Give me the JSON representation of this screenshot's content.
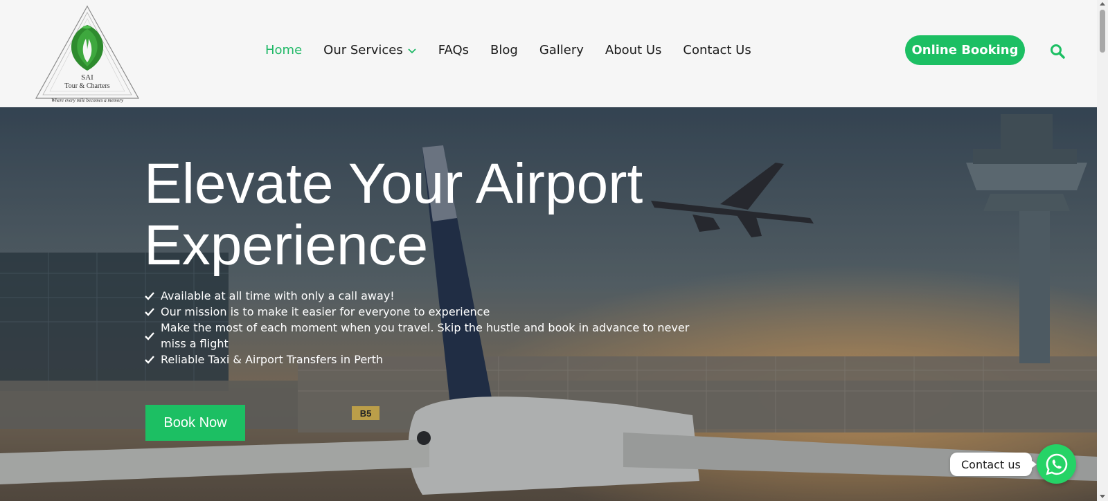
{
  "logo": {
    "name": "SAI",
    "subtitle": "Tour & Charters",
    "tagline": "Where every mile becomes a memory"
  },
  "nav": {
    "items": [
      {
        "label": "Home",
        "active": true
      },
      {
        "label": "Our Services",
        "has_dropdown": true
      },
      {
        "label": "FAQs"
      },
      {
        "label": "Blog"
      },
      {
        "label": "Gallery"
      },
      {
        "label": "About Us"
      },
      {
        "label": "Contact Us"
      }
    ],
    "booking_label": "Online Booking",
    "search_icon": "search-icon"
  },
  "hero": {
    "title_line1": "Elevate Your Airport",
    "title_line2": "Experience",
    "bullets": [
      "Available at all time with only a call away!",
      "Our mission is to make it easier for everyone to experience",
      "Make the most of each moment when you travel. Skip the hustle and book in advance to never miss a flight",
      "Reliable Taxi & Airport Transfers in Perth"
    ],
    "cta_label": "Book Now",
    "gate_sign": "B5"
  },
  "contact_widget": {
    "label": "Contact us",
    "icon": "whatsapp-icon"
  },
  "colors": {
    "accent": "#1cbf63",
    "active_nav": "#1fb866",
    "whatsapp": "#25d366",
    "header_bg": "#f6f6f6"
  }
}
